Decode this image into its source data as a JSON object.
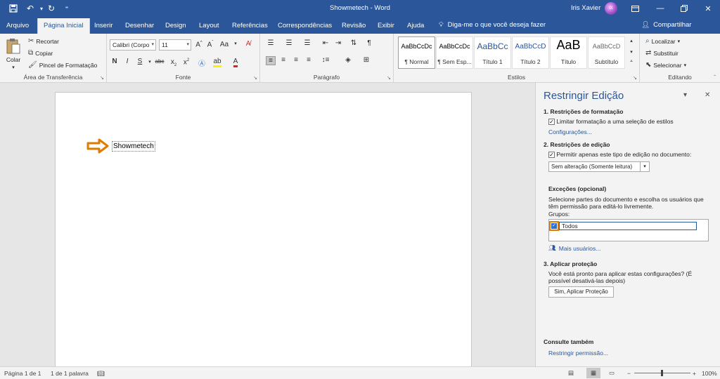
{
  "titlebar": {
    "title": "Showmetech - Word",
    "user": "Iris Xavier",
    "avatar_initials": "iX",
    "icons": {
      "save": "save-icon",
      "undo": "undo-icon",
      "redo": "redo-icon",
      "customize": "customize-icon"
    }
  },
  "tabs": [
    "Arquivo",
    "Página Inicial",
    "Inserir",
    "Desenhar",
    "Design",
    "Layout",
    "Referências",
    "Correspondências",
    "Revisão",
    "Exibir",
    "Ajuda"
  ],
  "tell_me": "Diga-me o que você deseja fazer",
  "share": "Compartilhar",
  "clipboard": {
    "paste": "Colar",
    "cut": "Recortar",
    "copy": "Copiar",
    "format_painter": "Pincel de Formatação",
    "label": "Área de Transferência"
  },
  "font": {
    "name": "Calibri (Corpo",
    "size": "11",
    "label": "Fonte"
  },
  "paragraph": {
    "label": "Parágrafo"
  },
  "styles": {
    "label": "Estilos",
    "items": [
      {
        "sample": "AaBbCcDc",
        "name": "¶ Normal"
      },
      {
        "sample": "AaBbCcDc",
        "name": "¶ Sem Esp..."
      },
      {
        "sample": "AaBbCc",
        "name": "Título 1"
      },
      {
        "sample": "AaBbCcD",
        "name": "Título 2"
      },
      {
        "sample": "AaB",
        "name": "Título"
      },
      {
        "sample": "AaBbCcD",
        "name": "Subtítulo"
      }
    ]
  },
  "editing": {
    "find": "Localizar",
    "replace": "Substituir",
    "select": "Selecionar",
    "label": "Editando"
  },
  "document": {
    "text": "Showmetech"
  },
  "pane": {
    "title": "Restringir Edição",
    "s1_title": "1. Restrições de formatação",
    "s1_check": "Limitar formatação a uma seleção de estilos",
    "s1_link": "Configurações...",
    "s2_title": "2. Restrições de edição",
    "s2_check": "Permitir apenas este tipo de edição no documento:",
    "s2_select": "Sem alteração (Somente leitura)",
    "exc_title": "Exceções (opcional)",
    "exc_text1": "Selecione partes do documento e escolha os usuários que",
    "exc_text2": "têm permissão para editá-lo livremente.",
    "groups_label": "Grupos:",
    "group_item": "Todos",
    "more_users": "Mais usuários...",
    "s3_title": "3. Aplicar proteção",
    "s3_text1": "Você está pronto para aplicar estas configurações? (É",
    "s3_text2": "possível desativá-las depois)",
    "s3_button": "Sim, Aplicar Proteção",
    "see_also": "Consulte também",
    "see_also_link": "Restringir permissão..."
  },
  "status": {
    "page": "Página 1 de 1",
    "words": "1 de 1 palavra",
    "zoom": "100%"
  },
  "colors": {
    "brand": "#2b579a",
    "highlight": "#e07b00"
  }
}
